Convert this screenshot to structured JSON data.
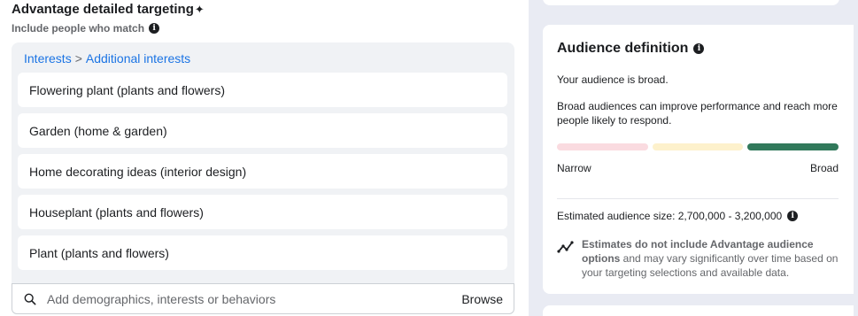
{
  "targeting": {
    "title": "Advantage detailed targeting",
    "sparkle": "✦",
    "subtitle": "Include people who match",
    "breadcrumb": {
      "parent": "Interests",
      "separator": ">",
      "child": "Additional interests"
    },
    "interests": [
      "Flowering plant (plants and flowers)",
      "Garden (home & garden)",
      "Home decorating ideas (interior design)",
      "Houseplant (plants and flowers)",
      "Plant (plants and flowers)"
    ],
    "search": {
      "placeholder": "Add demographics, interests or behaviors",
      "value": "",
      "browse_label": "Browse"
    }
  },
  "audience": {
    "title": "Audience definition",
    "status": "Your audience is broad.",
    "description": "Broad audiences can improve performance and reach more people likely to respond.",
    "meter": {
      "low_label": "Narrow",
      "high_label": "Broad",
      "active_segment": 3,
      "colors": [
        "#fadbe0",
        "#fdf1cc",
        "#31795b"
      ]
    },
    "estimated_size_label": "Estimated audience size: 2,700,000 - 3,200,000",
    "note_bold": "Estimates do not include Advantage audience options",
    "note_rest": " and may vary significantly over time based on your targeting selections and available data."
  },
  "colors": {
    "link": "#1b74e4",
    "panel_bg": "#f0f2f5",
    "right_bg": "#e9ebf3"
  },
  "icons": {
    "info": "info-icon",
    "search": "search-icon",
    "trend": "trend-line-icon"
  }
}
